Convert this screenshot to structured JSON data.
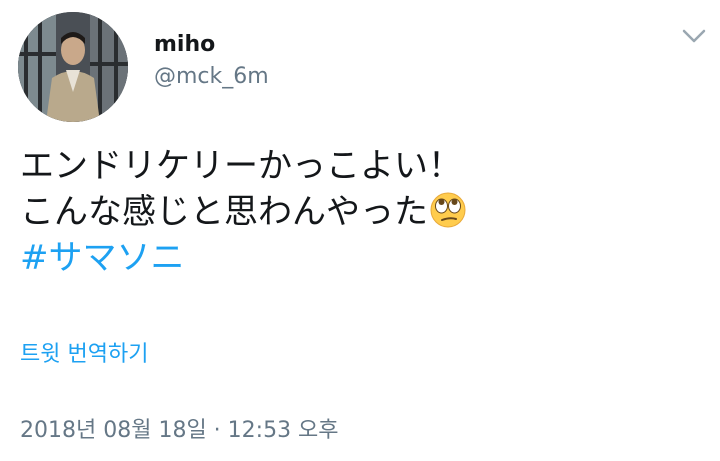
{
  "tweet": {
    "author": {
      "display_name": "miho",
      "handle": "@mck_6m",
      "avatar_icon": "profile-photo"
    },
    "text_lines": [
      "エンドリケリーかっこよい！",
      "こんな感じと思わんやった"
    ],
    "emoji": "face-with-rolling-eyes-emoji",
    "hashtag": "#サマソニ",
    "translate_label": "트윗 번역하기",
    "timestamp": "2018년 08월 18일 · 12:53 오후",
    "menu_icon": "chevron-down-icon",
    "colors": {
      "link": "#1da1f2",
      "secondary_text": "#657786",
      "primary_text": "#14171a"
    }
  }
}
